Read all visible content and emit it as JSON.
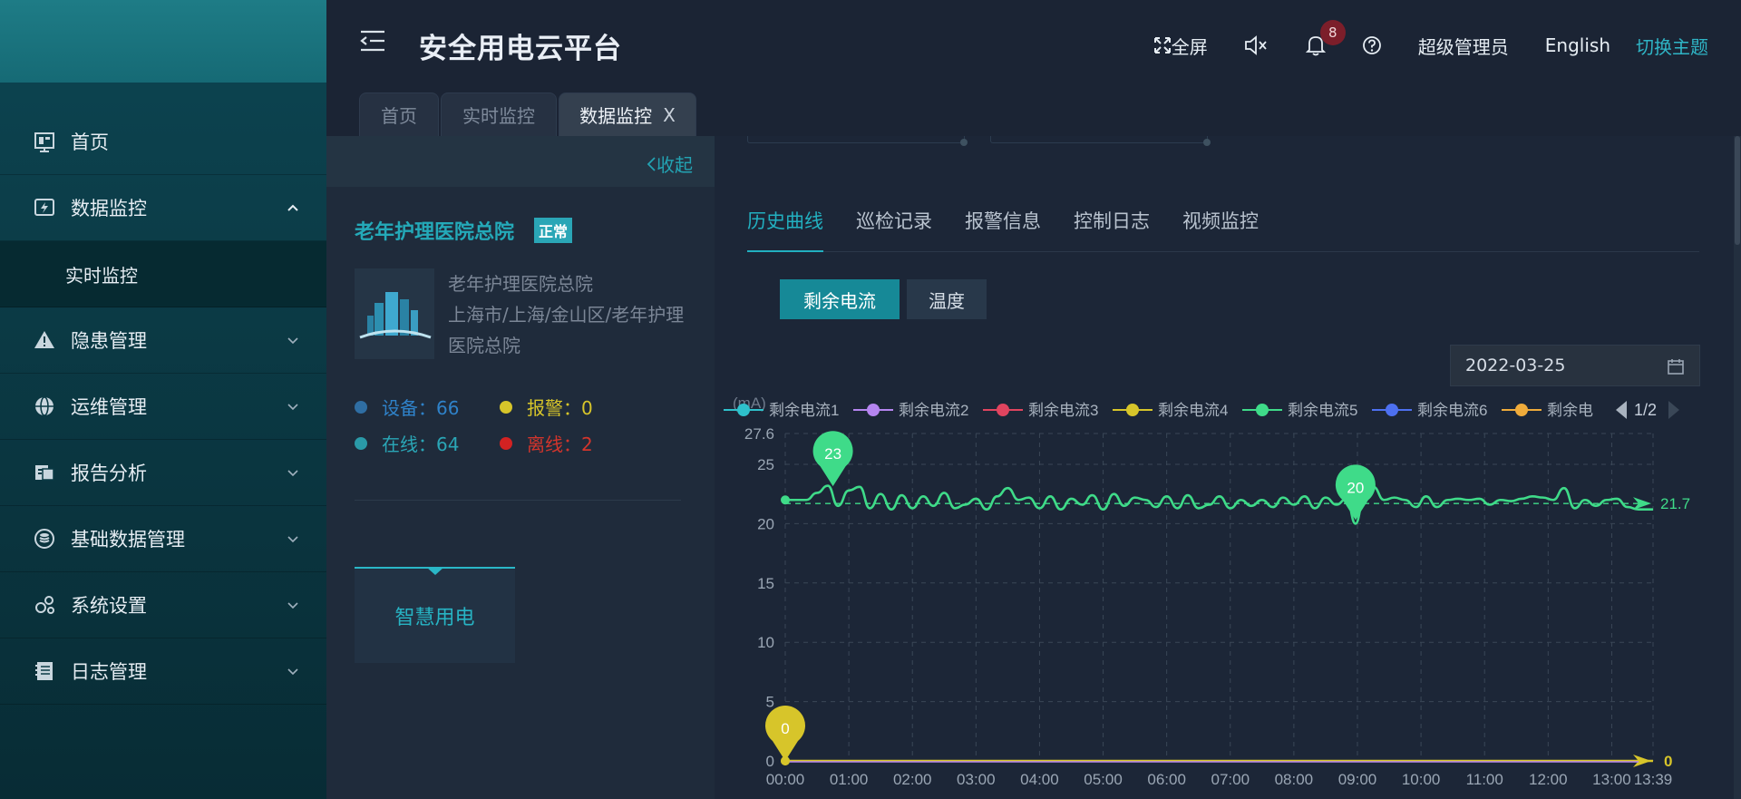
{
  "colors": {
    "accent": "#22b0c0",
    "sidebar": "#0b3a45",
    "header": "#1b2434",
    "content": "#1c2637"
  },
  "header": {
    "title": "安全用电云平台",
    "fullscreen": "全屏",
    "notifications": "8",
    "user": "超级管理员",
    "language": "English",
    "theme": "切换主题",
    "icons": [
      "menu-fold-icon",
      "fullscreen-icon",
      "mute-icon",
      "bell-icon",
      "help-icon"
    ]
  },
  "sidebar": {
    "items": [
      {
        "label": "首页",
        "icon": "home-icon"
      },
      {
        "label": "数据监控",
        "icon": "monitor-icon",
        "expanded": true
      },
      {
        "label": "实时监控",
        "sub": true
      },
      {
        "label": "隐患管理",
        "icon": "warning-icon"
      },
      {
        "label": "运维管理",
        "icon": "globe-icon"
      },
      {
        "label": "报告分析",
        "icon": "report-icon"
      },
      {
        "label": "基础数据管理",
        "icon": "database-icon"
      },
      {
        "label": "系统设置",
        "icon": "settings-icon"
      },
      {
        "label": "日志管理",
        "icon": "log-icon"
      }
    ]
  },
  "tabs": [
    {
      "label": "首页"
    },
    {
      "label": "实时监控"
    },
    {
      "label": "数据监控",
      "active": true,
      "close": "X"
    }
  ],
  "left_panel": {
    "collapse": "收起",
    "org_name": "老年护理医院总院",
    "status": "正常",
    "info_line1": "老年护理医院总院",
    "info_line2": "上海市/上海/金山区/老年护理医院总院",
    "stats": {
      "devices": "设备：66",
      "alarms": "报警：0",
      "online": "在线：64",
      "offline": "离线：2"
    },
    "card": "智慧用电"
  },
  "right_panel": {
    "subtabs": [
      "历史曲线",
      "巡检记录",
      "报警信息",
      "控制日志",
      "视频监控"
    ],
    "buttons": {
      "current": "剩余电流",
      "temp": "温度"
    },
    "date": "2022-03-25"
  },
  "chart_data": {
    "type": "line",
    "ylabel": "(mA)",
    "ylim": [
      0,
      27.6
    ],
    "yticks": [
      "27.6",
      "25",
      "20",
      "15",
      "10",
      "5",
      "0"
    ],
    "xticks": [
      "00:00",
      "01:00",
      "02:00",
      "03:00",
      "04:00",
      "05:00",
      "06:00",
      "07:00",
      "08:00",
      "09:00",
      "10:00",
      "11:00",
      "12:00",
      "13:00",
      "13:39"
    ],
    "legend": [
      "剩余电流1",
      "剩余电流2",
      "剩余电流3",
      "剩余电流4",
      "剩余电流5",
      "剩余电流6",
      "剩余电"
    ],
    "legend_colors": [
      "#2ec1cc",
      "#b585f0",
      "#e0445f",
      "#d7c52a",
      "#3fdb89",
      "#4d70f0",
      "#efab3b"
    ],
    "legend_page": "1/2",
    "series": [
      {
        "name": "剩余电流5",
        "color": "#3fdb89",
        "x": [
          0,
          0.33,
          0.5,
          0.67,
          0.83,
          1.0,
          1.17,
          1.33,
          1.5,
          1.67,
          1.83,
          2.0,
          2.17,
          2.33,
          2.5,
          2.67,
          2.83,
          3.0,
          3.17,
          3.33,
          3.5,
          3.67,
          3.83,
          4.0,
          4.17,
          4.33,
          4.5,
          4.67,
          4.83,
          5.0,
          5.17,
          5.33,
          5.5,
          5.67,
          5.83,
          6.0,
          6.17,
          6.33,
          6.5,
          6.67,
          6.83,
          7.0,
          7.17,
          7.33,
          7.5,
          7.67,
          7.83,
          8.0,
          8.17,
          8.33,
          8.5,
          8.67,
          8.83,
          8.97,
          9.1,
          9.25,
          9.42,
          9.58,
          9.75,
          9.92,
          10.08,
          10.25,
          10.42,
          10.58,
          10.75,
          10.92,
          11.08,
          11.25,
          11.42,
          11.58,
          11.75,
          11.92,
          12.08,
          12.25,
          12.42,
          12.58,
          12.75,
          12.92,
          13.08,
          13.25,
          13.42,
          13.65
        ],
        "values": [
          22.0,
          22.0,
          22.6,
          23.2,
          21.5,
          22.8,
          23.1,
          21.3,
          22.5,
          21.2,
          22.4,
          21.3,
          22.3,
          21.5,
          22.6,
          21.3,
          21.6,
          22.1,
          21.2,
          22.3,
          23.0,
          22.0,
          22.2,
          21.3,
          22.3,
          21.2,
          22.1,
          21.6,
          22.4,
          21.2,
          22.5,
          21.5,
          22.2,
          22.0,
          21.4,
          22.3,
          21.3,
          22.4,
          21.3,
          21.6,
          22.3,
          21.3,
          22.0,
          21.5,
          22.0,
          21.4,
          22.2,
          21.6,
          22.3,
          21.3,
          22.2,
          21.6,
          22.1,
          20.0,
          22.0,
          23.1,
          22.0,
          22.2,
          22.0,
          21.4,
          22.3,
          21.4,
          22.0,
          22.1,
          22.0,
          22.1,
          21.6,
          22.0,
          21.9,
          22.1,
          22.3,
          22.2,
          22.0,
          23.0,
          21.3,
          22.0,
          21.5,
          22.0,
          22.1,
          21.4,
          21.2,
          21.2
        ],
        "max": {
          "x": 0.75,
          "value": 23,
          "label": "23"
        },
        "min": {
          "x": 8.97,
          "value": 20,
          "label": "20"
        },
        "average": 21.7,
        "average_label": "21.7"
      },
      {
        "name": "剩余电流4",
        "color": "#d7c52a",
        "x": [
          0,
          13.65
        ],
        "values": [
          0,
          0
        ],
        "marker": {
          "x": 0,
          "value": 0,
          "label": "0"
        },
        "end_label": "0"
      }
    ]
  }
}
